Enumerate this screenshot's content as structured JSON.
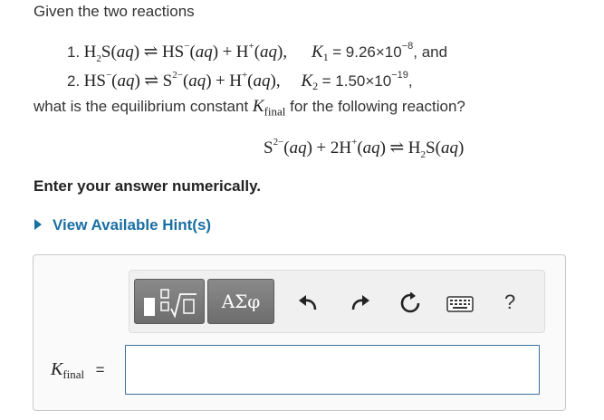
{
  "intro": "Given the two reactions",
  "reaction1": {
    "number": "1.",
    "lhs": "H",
    "lhs_sub": "2",
    "lhs_tail": "S(",
    "aq": "aq",
    "close": ")",
    "arrow": "⇌",
    "hs": "HS",
    "minus": "−",
    "plus_op": "+",
    "hplus": "H",
    "plus_sup": "+",
    "comma": ",",
    "k_sym": "K",
    "k_sub": "1",
    "k_value": " = 9.26×10",
    "k_exp": "−8",
    "tail": ", and"
  },
  "reaction2": {
    "number": "2.",
    "hs": "HS",
    "minus": "−",
    "arrow": "⇌",
    "s": "S",
    "s_sup": "2−",
    "plus_op": "+",
    "hplus": "H",
    "plus_sup": "+",
    "k_sym": "K",
    "k_sub": "2",
    "k_value": " = 1.50×10",
    "k_exp": "−19",
    "tail": ","
  },
  "question_prefix": "what is the equilibrium constant ",
  "question_k": "K",
  "question_k_sub": "final",
  "question_suffix": " for the following reaction?",
  "final_reaction": {
    "s": "S",
    "s_sup": "2−",
    "aq": "aq",
    "plus_op": "+ 2H",
    "plus_sup": "+",
    "arrow": "⇌",
    "h2": "H",
    "h2_sub": "2",
    "h2_tail": "S("
  },
  "instruction": "Enter your answer numerically.",
  "hint_link": "View Available Hint(s)",
  "toolbar": {
    "templates_icon": "radical-template-icon",
    "symbols_label": "ΑΣφ",
    "undo_icon": "undo-icon",
    "redo_icon": "redo-icon",
    "reset_icon": "reset-icon",
    "keyboard_icon": "keyboard-icon",
    "help_label": "?"
  },
  "answer_label_k": "K",
  "answer_label_sub": "final",
  "answer_label_eq": "=",
  "answer_value": ""
}
